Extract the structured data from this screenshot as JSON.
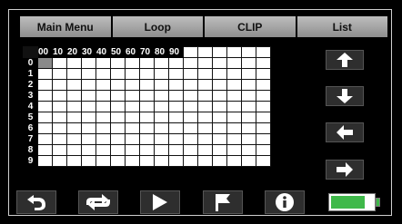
{
  "menu": {
    "tabs": [
      {
        "label": "Main Menu"
      },
      {
        "label": "Loop"
      },
      {
        "label": "CLIP"
      },
      {
        "label": "List"
      }
    ]
  },
  "grid": {
    "column_labels": [
      "00",
      "10",
      "20",
      "30",
      "40",
      "50",
      "60",
      "70",
      "80",
      "90"
    ],
    "row_labels": [
      "0",
      "1",
      "2",
      "3",
      "4",
      "5",
      "6",
      "7",
      "8",
      "9"
    ],
    "selected_cell": {
      "row": "0",
      "column": "00"
    }
  },
  "side_buttons": [
    {
      "icon": "arrow-up-icon"
    },
    {
      "icon": "arrow-down-icon"
    },
    {
      "icon": "arrow-left-icon"
    },
    {
      "icon": "arrow-right-icon"
    }
  ],
  "toolbar": [
    {
      "icon": "back-icon"
    },
    {
      "icon": "repeat-icon"
    },
    {
      "icon": "play-icon"
    },
    {
      "icon": "flag-icon"
    },
    {
      "icon": "info-icon"
    }
  ],
  "battery": {
    "level": 0.8,
    "color": "#3fb94a"
  },
  "colors": {
    "background": "#000000",
    "tab": "#a9a9a9",
    "button": "#2e2e2e",
    "selected_cell": "#8a8a8a"
  }
}
